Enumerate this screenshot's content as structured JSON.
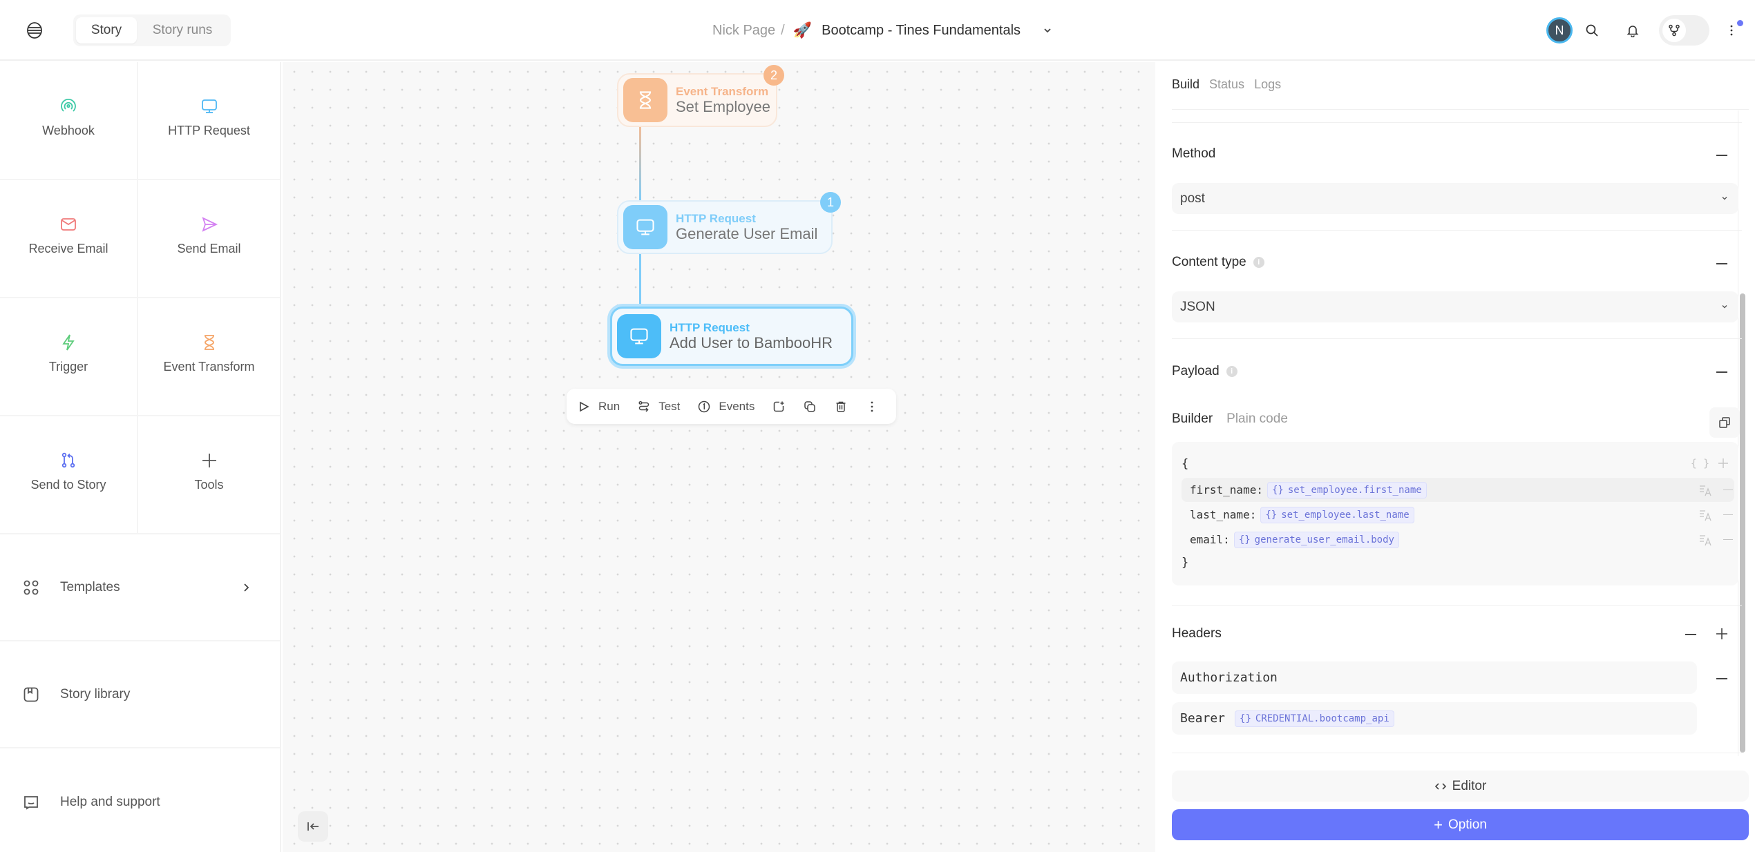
{
  "header": {
    "segments": [
      {
        "label": "Story",
        "active": true
      },
      {
        "label": "Story runs",
        "active": false
      }
    ],
    "breadcrumb": {
      "owner": "Nick Page",
      "separator": "/",
      "story_emoji": "🚀",
      "story_title": "Bootcamp - Tines Fundamentals"
    },
    "user_initial": "N",
    "colors": {
      "avatar_ring": "#4bb8ef",
      "notification_dot": "#6b77f7"
    }
  },
  "sidebar": {
    "actions": [
      {
        "label": "Webhook",
        "icon": "webhook-icon",
        "color": "#3cc9a6"
      },
      {
        "label": "HTTP Request",
        "icon": "monitor-icon",
        "color": "#4fb8f4"
      },
      {
        "label": "Receive Email",
        "icon": "envelope-icon",
        "color": "#f07a7a"
      },
      {
        "label": "Send Email",
        "icon": "send-icon",
        "color": "#d481f2"
      },
      {
        "label": "Trigger",
        "icon": "lightning-icon",
        "color": "#5ccc7a"
      },
      {
        "label": "Event Transform",
        "icon": "hourglass-icon",
        "color": "#f5a66a"
      },
      {
        "label": "Send to Story",
        "icon": "send-to-story-icon",
        "color": "#5b6ef0"
      },
      {
        "label": "Tools",
        "icon": "plus-icon",
        "color": "#555555"
      }
    ],
    "links": [
      {
        "label": "Templates",
        "icon": "templates-icon",
        "has_chevron": true
      },
      {
        "label": "Story library",
        "icon": "library-icon",
        "has_chevron": false
      },
      {
        "label": "Help and support",
        "icon": "chat-icon",
        "has_chevron": false
      }
    ]
  },
  "canvas": {
    "nodes": [
      {
        "type": "Event Transform",
        "name": "Set Employee",
        "badge": "2",
        "color": "#f8b88a",
        "selected": false
      },
      {
        "type": "HTTP Request",
        "name": "Generate User Email",
        "badge": "1",
        "color": "#7fcdf9",
        "selected": false
      },
      {
        "type": "HTTP Request",
        "name": "Add User to BambooHR",
        "badge": null,
        "color": "#4dbdf8",
        "selected": true
      }
    ],
    "toolbar": {
      "run": "Run",
      "test": "Test",
      "events": "Events"
    }
  },
  "panel": {
    "tabs": [
      {
        "label": "Build",
        "active": true
      },
      {
        "label": "Status",
        "active": false
      },
      {
        "label": "Logs",
        "active": false
      }
    ],
    "method": {
      "label": "Method",
      "value": "post"
    },
    "content_type": {
      "label": "Content type",
      "value": "JSON"
    },
    "payload": {
      "label": "Payload",
      "modes": [
        {
          "label": "Builder",
          "active": true
        },
        {
          "label": "Plain code",
          "active": false
        }
      ],
      "open_brace": "{",
      "close_brace": "}",
      "fields": [
        {
          "key": "first_name",
          "ref": "set_employee.first_name"
        },
        {
          "key": "last_name",
          "ref": "set_employee.last_name"
        },
        {
          "key": "email",
          "ref": "generate_user_email.body"
        }
      ]
    },
    "headers": {
      "label": "Headers",
      "key": "Authorization",
      "value_prefix": "Bearer",
      "value_ref": "CREDENTIAL.bootcamp_api"
    },
    "editor_label": "Editor",
    "option_label": "Option",
    "colors": {
      "primary": "#6776fb",
      "pill_text": "#6b73d8"
    }
  }
}
